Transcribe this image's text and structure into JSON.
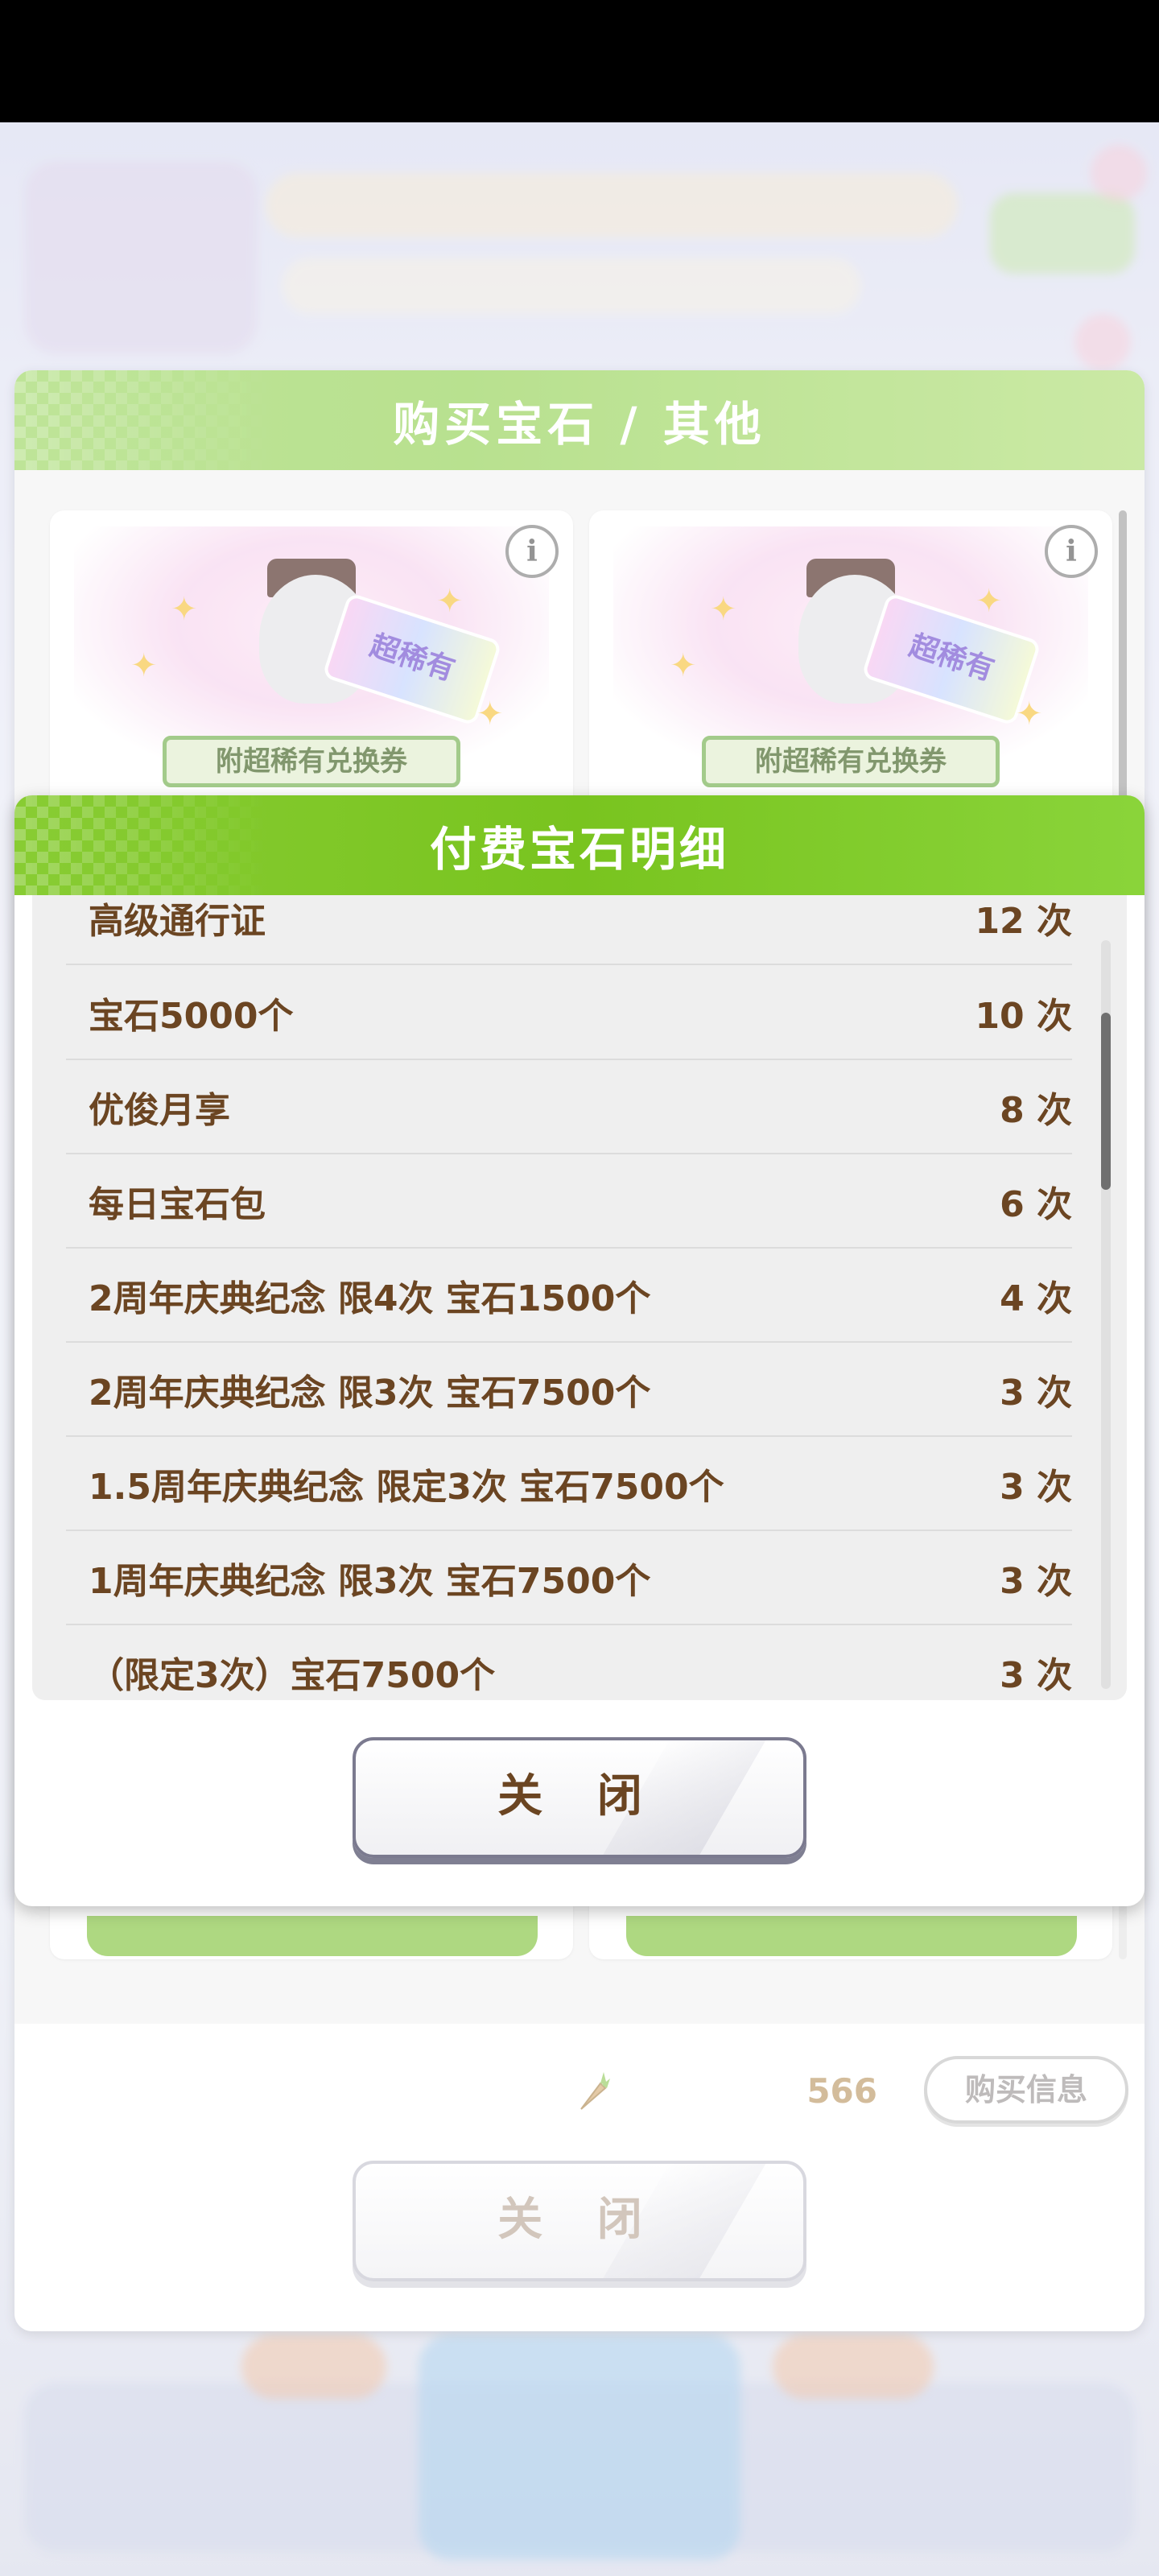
{
  "background_dialog": {
    "title": "购买宝石 / 其他",
    "cards": [
      {
        "plate_text": "附超稀有兑换券",
        "ribbon_text": "超稀有",
        "info_icon": "i"
      },
      {
        "plate_text": "附超稀有兑换券",
        "ribbon_text": "超稀有",
        "info_icon": "i"
      }
    ],
    "carrot_count": "566",
    "purchase_info_label": "购买信息",
    "close_label": "关 闭"
  },
  "detail_dialog": {
    "title": "付费宝石明细",
    "rows": [
      {
        "name": "高级通行证",
        "count": "12 次"
      },
      {
        "name": "宝石5000个",
        "count": "10 次"
      },
      {
        "name": "优俊月享",
        "count": "8 次"
      },
      {
        "name": "每日宝石包",
        "count": "6 次"
      },
      {
        "name": "2周年庆典纪念  限4次  宝石1500个",
        "count": "4 次"
      },
      {
        "name": "2周年庆典纪念  限3次  宝石7500个",
        "count": "3 次"
      },
      {
        "name": "1.5周年庆典纪念  限定3次  宝石7500个",
        "count": "3 次"
      },
      {
        "name": "1周年庆典纪念  限3次  宝石7500个",
        "count": "3 次"
      },
      {
        "name": "（限定3次）宝石7500个",
        "count": "3 次"
      }
    ],
    "close_label": "关 闭"
  },
  "colors": {
    "header_green": "#79c41f",
    "text_brown": "#6b4522",
    "star_yellow": "#f6c84c"
  }
}
